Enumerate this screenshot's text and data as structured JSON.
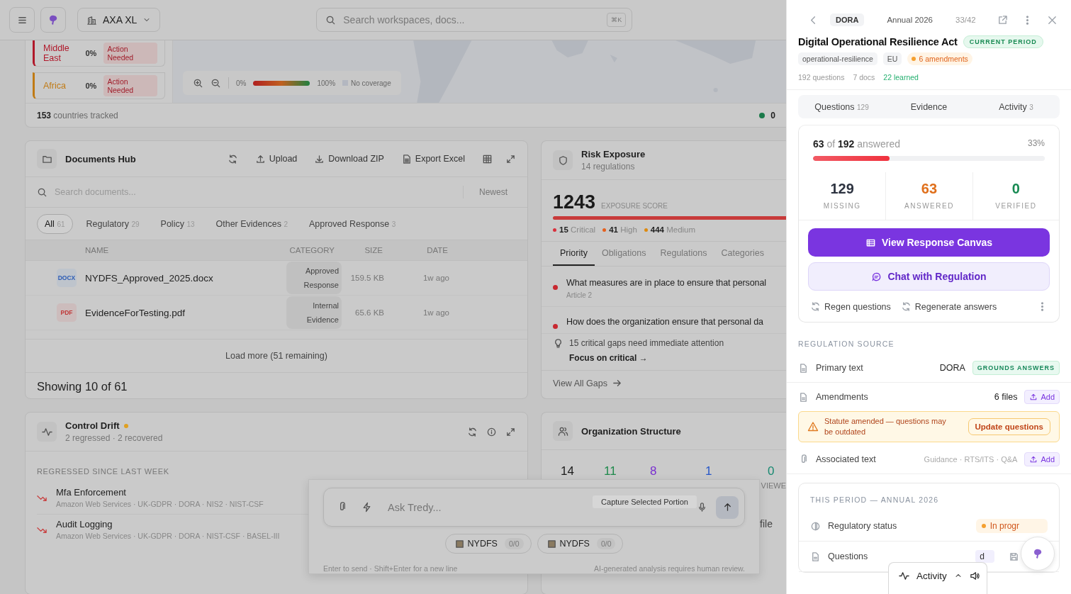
{
  "topbar": {
    "workspace": "AXA XL",
    "search": {
      "placeholder": "Search workspaces, docs..."
    },
    "shortcut": "⌘K"
  },
  "coverage_map": {
    "regions": [
      {
        "name": "Middle East",
        "percent": "0%",
        "status": "Action Needed",
        "color": "#b0182a"
      },
      {
        "name": "Africa",
        "percent": "0%",
        "status": "Action Needed",
        "color": "#c07a14"
      }
    ],
    "legend": {
      "min": "0%",
      "max": "100%",
      "none": "No coverage"
    },
    "footer_count": "153",
    "footer_label": "countries tracked",
    "compliant_count": "0"
  },
  "documents_hub": {
    "title": "Documents Hub",
    "actions": [
      "Upload",
      "Download ZIP",
      "Export Excel"
    ],
    "search": {
      "placeholder": "Search documents..."
    },
    "sort": "Newest",
    "filters": [
      {
        "label": "All",
        "count": "61",
        "selected": true
      },
      {
        "label": "Regulatory",
        "count": "29",
        "selected": false
      },
      {
        "label": "Policy",
        "count": "13",
        "selected": false
      },
      {
        "label": "Other Evidences",
        "count": "2",
        "selected": false
      },
      {
        "label": "Approved Response",
        "count": "3",
        "selected": false
      }
    ],
    "columns": [
      "NAME",
      "CATEGORY",
      "SIZE",
      "DATE"
    ],
    "rows": [
      {
        "kind": "docx",
        "type": "DOCX",
        "name": "NYDFS_Approved_2025.docx",
        "category": "Approved Response",
        "size": "159.5 KB",
        "date": "1w ago"
      },
      {
        "kind": "pdf",
        "type": "PDF",
        "name": "EvidenceForTesting.pdf",
        "category": "Internal Evidence",
        "size": "65.6 KB",
        "date": "1w ago"
      }
    ],
    "load_more": "Load more (51 remaining)",
    "showing": "Showing 10 of 61"
  },
  "risk_exposure": {
    "title": "Risk Exposure",
    "subtitle": "14 regulations",
    "score": "1243",
    "score_label": "EXPOSURE SCORE",
    "severities": [
      {
        "count": "15",
        "label": "Critical",
        "color": "#d9303c"
      },
      {
        "count": "41",
        "label": "High",
        "color": "#e5601e"
      },
      {
        "count": "444",
        "label": "Medium",
        "color": "#dd8a10"
      }
    ],
    "tabs": [
      {
        "label": "Priority",
        "selected": true
      },
      {
        "label": "Obligations",
        "selected": false
      },
      {
        "label": "Regulations",
        "selected": false
      },
      {
        "label": "Categories",
        "selected": false
      }
    ],
    "items": [
      {
        "question": "What measures are in place to ensure that personal",
        "article": "Article 2"
      },
      {
        "question": "How does the organization ensure that personal da"
      }
    ],
    "hint": "15 critical gaps need immediate attention",
    "hint_action": "Focus on critical →",
    "footer_link": "View All Gaps"
  },
  "control_drift": {
    "title": "Control Drift",
    "subtitle": "2 regressed · 2 recovered",
    "section": "REGRESSED SINCE LAST WEEK",
    "items": [
      {
        "name": "Mfa Enforcement",
        "frameworks": "Amazon Web Services · UK-GDPR · DORA · NIS2 · NIST-CSF"
      },
      {
        "name": "Audit Logging",
        "frameworks": "Amazon Web Services · UK-GDPR · DORA · NIST-CSF · BASEL-III"
      }
    ]
  },
  "org_structure": {
    "title": "Organization Structure",
    "stats": [
      {
        "value": "14",
        "color": "#1c1c1c"
      },
      {
        "value": "11",
        "color": "#1f8a4c"
      },
      {
        "value": "8",
        "color": "#7a2fd0"
      },
      {
        "value": "1",
        "color": "#2757c9"
      },
      {
        "value": "0",
        "color": "#188a72"
      }
    ],
    "label": "VIEWE",
    "row_text": "file"
  },
  "chat": {
    "placeholder": "Ask Tredy...",
    "tooltip": "Capture Selected Portion",
    "chips": [
      {
        "label": "NYDFS",
        "count": "0/0"
      },
      {
        "label": "NYDFS",
        "count": "0/0"
      }
    ],
    "hint_left": "Enter to send · Shift+Enter for a new line",
    "hint_right": "AI-generated analysis requires human review."
  },
  "drawer": {
    "breadcrumb": {
      "code": "DORA",
      "period": "Annual 2026",
      "position": "33/42"
    },
    "title": "Digital Operational Resilience Act",
    "badge": "CURRENT PERIOD",
    "tags": [
      {
        "label": "operational-resilience",
        "kind": "plain"
      },
      {
        "label": "EU",
        "kind": "plain"
      },
      {
        "label": "6 amendments",
        "kind": "warning"
      }
    ],
    "meta": [
      {
        "text": "192 questions",
        "kind": "plain"
      },
      {
        "text": "7 docs",
        "kind": "plain"
      },
      {
        "text": "22 learned",
        "kind": "success"
      }
    ],
    "tabs": [
      {
        "label": "Questions",
        "count": "129"
      },
      {
        "label": "Evidence"
      },
      {
        "label": "Activity",
        "count": "3"
      }
    ],
    "progress": {
      "summary": "**63** of **192** answered",
      "percent": "33%",
      "level": 0.33
    },
    "stats": [
      {
        "value": "129",
        "label": "MISSING",
        "color": "#2d3340"
      },
      {
        "value": "63",
        "label": "ANSWERED",
        "color": "#e0701c"
      },
      {
        "value": "0",
        "label": "VERIFIED",
        "color": "#178a52"
      }
    ],
    "primary_button": "View Response Canvas",
    "secondary_button": "Chat with Regulation",
    "links": [
      "Regen questions",
      "Regenerate answers"
    ],
    "source": {
      "title": "REGULATION SOURCE",
      "rows": [
        {
          "kind": "primary",
          "label": "Primary text",
          "value": "DORA",
          "badge": "GROUNDS ANSWERS"
        },
        {
          "kind": "files",
          "label": "Amendments",
          "value": "6 files",
          "action": "Add"
        },
        {
          "kind": "warning",
          "text": "Statute amended — questions may be outdated",
          "action": "Update questions"
        },
        {
          "kind": "associated",
          "label": "Associated text",
          "value": "Guidance · RTS/ITS · Q&A",
          "action": "Add"
        }
      ]
    },
    "period": {
      "title": "THIS PERIOD — ANNUAL 2026",
      "rows": [
        {
          "label": "Regulatory status",
          "badge": "In progr",
          "kind": "status"
        },
        {
          "label": "Questions",
          "badge": "d",
          "kind": "questions"
        }
      ]
    },
    "activity_bar": {
      "label": "Activity"
    }
  }
}
